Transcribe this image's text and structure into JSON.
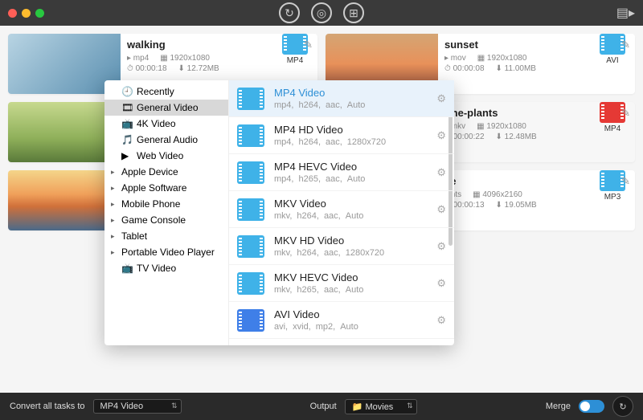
{
  "titlebar": {
    "top_icons": [
      "refresh-icon",
      "disc-icon",
      "film-icon"
    ]
  },
  "cards": [
    {
      "title": "walking",
      "container": "mp4",
      "resolution": "1920x1080",
      "duration": "00:00:18",
      "size": "12.72MB",
      "badge": "MP4",
      "thumb": "linear-gradient(135deg,#b8d4e3,#5a8fb0)"
    },
    {
      "title": "sunset",
      "container": "mov",
      "resolution": "1920x1080",
      "duration": "00:00:08",
      "size": "11.00MB",
      "badge": "AVI",
      "thumb": "linear-gradient(180deg,#d4a574 0%,#e8915a 50%,#8a4a3a 100%)"
    },
    {
      "title": "",
      "container": "",
      "resolution": "",
      "duration": "",
      "size": "",
      "badge": "",
      "thumb": "linear-gradient(180deg,#c7d98f 0%,#8fb05a 60%,#5a7a3a 100%)"
    },
    {
      "title": "rine-plants",
      "container": "mkv",
      "resolution": "1920x1080",
      "duration": "00:00:22",
      "size": "12.48MB",
      "badge": "MP4",
      "badge_red": true,
      "thumb": ""
    },
    {
      "title": "",
      "container": "",
      "resolution": "",
      "duration": "",
      "size": "",
      "badge": "",
      "thumb": "linear-gradient(180deg,#f4d58a 0%,#f0a05a 40%,#d0703a 60%,#4a6a8a 100%)"
    },
    {
      "title": "ce",
      "container": "nts",
      "resolution": "4096x2160",
      "duration": "00:00:13",
      "size": "19.05MB",
      "badge": "MP3",
      "thumb": ""
    }
  ],
  "panel": {
    "cats": [
      {
        "label": "Recently",
        "icon": "clock",
        "expand": false
      },
      {
        "label": "General Video",
        "icon": "video",
        "expand": false,
        "sel": true
      },
      {
        "label": "4K Video",
        "icon": "4k",
        "expand": false
      },
      {
        "label": "General Audio",
        "icon": "audio",
        "expand": false
      },
      {
        "label": "Web Video",
        "icon": "web",
        "expand": false
      },
      {
        "label": "Apple Device",
        "icon": "",
        "expand": true
      },
      {
        "label": "Apple Software",
        "icon": "",
        "expand": true
      },
      {
        "label": "Mobile Phone",
        "icon": "",
        "expand": true
      },
      {
        "label": "Game Console",
        "icon": "",
        "expand": true
      },
      {
        "label": "Tablet",
        "icon": "",
        "expand": true
      },
      {
        "label": "Portable Video Player",
        "icon": "",
        "expand": true
      },
      {
        "label": "TV Video",
        "icon": "tv",
        "expand": false
      }
    ],
    "formats": [
      {
        "name": "MP4 Video",
        "codec": [
          "mp4,",
          "h264,",
          "aac,",
          "Auto"
        ],
        "sel": true
      },
      {
        "name": "MP4 HD Video",
        "codec": [
          "mp4,",
          "h264,",
          "aac,",
          "1280x720"
        ]
      },
      {
        "name": "MP4 HEVC Video",
        "codec": [
          "mp4,",
          "h265,",
          "aac,",
          "Auto"
        ]
      },
      {
        "name": "MKV Video",
        "codec": [
          "mkv,",
          "h264,",
          "aac,",
          "Auto"
        ]
      },
      {
        "name": "MKV HD Video",
        "codec": [
          "mkv,",
          "h264,",
          "aac,",
          "1280x720"
        ]
      },
      {
        "name": "MKV HEVC Video",
        "codec": [
          "mkv,",
          "h265,",
          "aac,",
          "Auto"
        ]
      },
      {
        "name": "AVI Video",
        "codec": [
          "avi,",
          "xvid,",
          "mp2,",
          "Auto"
        ],
        "avi": true
      }
    ]
  },
  "footer": {
    "convert_label": "Convert all tasks to",
    "convert_value": "MP4 Video",
    "output_label": "Output",
    "output_value": "Movies",
    "merge_label": "Merge"
  }
}
